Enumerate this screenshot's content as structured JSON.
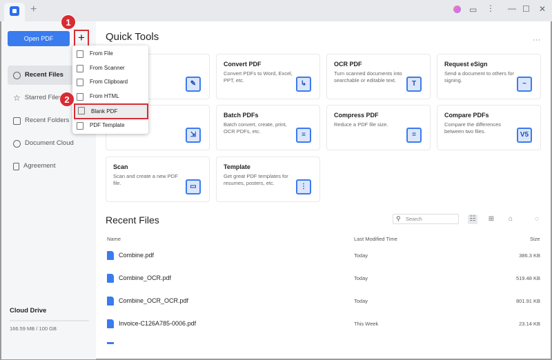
{
  "titlebar": {
    "new_tab": "+",
    "icons": [
      "avatar-icon",
      "feedback-icon",
      "more-vert-icon",
      "minimize-icon",
      "maximize-icon",
      "close-icon"
    ]
  },
  "sidebar": {
    "open_pdf": "Open PDF",
    "add": "+",
    "items": [
      {
        "label": "Recent Files",
        "active": true
      },
      {
        "label": "Starred Files"
      },
      {
        "label": "Recent Folders"
      },
      {
        "label": "Document Cloud"
      },
      {
        "label": "Agreement"
      }
    ],
    "cloud_title": "Cloud Drive",
    "cloud_usage": "166.59 MB / 100 GB"
  },
  "badges": [
    "1",
    "2"
  ],
  "menu": {
    "items": [
      "From File",
      "From Scanner",
      "From Clipboard",
      "From HTML",
      "Blank PDF",
      "PDF Template"
    ],
    "selected": "Blank PDF"
  },
  "quick_tools": {
    "title": "Quick Tools",
    "more": "···",
    "cards": [
      {
        "title": "",
        "desc": "mages in a",
        "icon": "edit-icon",
        "glyph": "✎"
      },
      {
        "title": "Convert PDF",
        "desc": "Convert PDFs to Word, Excel, PPT, etc.",
        "icon": "convert-icon",
        "glyph": "↳"
      },
      {
        "title": "OCR PDF",
        "desc": "Turn scanned documents into searchable or editable text.",
        "icon": "ocr-icon",
        "glyph": "T"
      },
      {
        "title": "Request eSign",
        "desc": "Send a document to others for signing.",
        "icon": "esign-icon",
        "glyph": "~"
      },
      {
        "title": "PDFs",
        "desc": "iple files DF.",
        "icon": "combine-icon",
        "glyph": "⇲"
      },
      {
        "title": "Batch PDFs",
        "desc": "Batch convert, create, print, OCR PDFs, etc.",
        "icon": "batch-icon",
        "glyph": "≡"
      },
      {
        "title": "Compress PDF",
        "desc": "Reduce a PDF file size.",
        "icon": "compress-icon",
        "glyph": "="
      },
      {
        "title": "Compare PDFs",
        "desc": "Compare the differences between two files.",
        "icon": "compare-icon",
        "glyph": "V5"
      },
      {
        "title": "Scan",
        "desc": "Scan and create a new PDF file.",
        "icon": "scan-icon",
        "glyph": "▭"
      },
      {
        "title": "Template",
        "desc": "Get great PDF templates for resumes, posters, etc.",
        "icon": "template-icon",
        "glyph": "⋮"
      }
    ]
  },
  "recent": {
    "title": "Recent Files",
    "search_placeholder": "Search",
    "columns": [
      "Name",
      "Last Modified Time",
      "Size"
    ],
    "files": [
      {
        "name": "Combine.pdf",
        "time": "Today",
        "size": "386.3 KB"
      },
      {
        "name": "Combine_OCR.pdf",
        "time": "Today",
        "size": "519.48 KB"
      },
      {
        "name": "Combine_OCR_OCR.pdf",
        "time": "Today",
        "size": "801.91 KB"
      },
      {
        "name": "Invoice-C126A785-0006.pdf",
        "time": "This Week",
        "size": "23.14 KB"
      }
    ]
  }
}
